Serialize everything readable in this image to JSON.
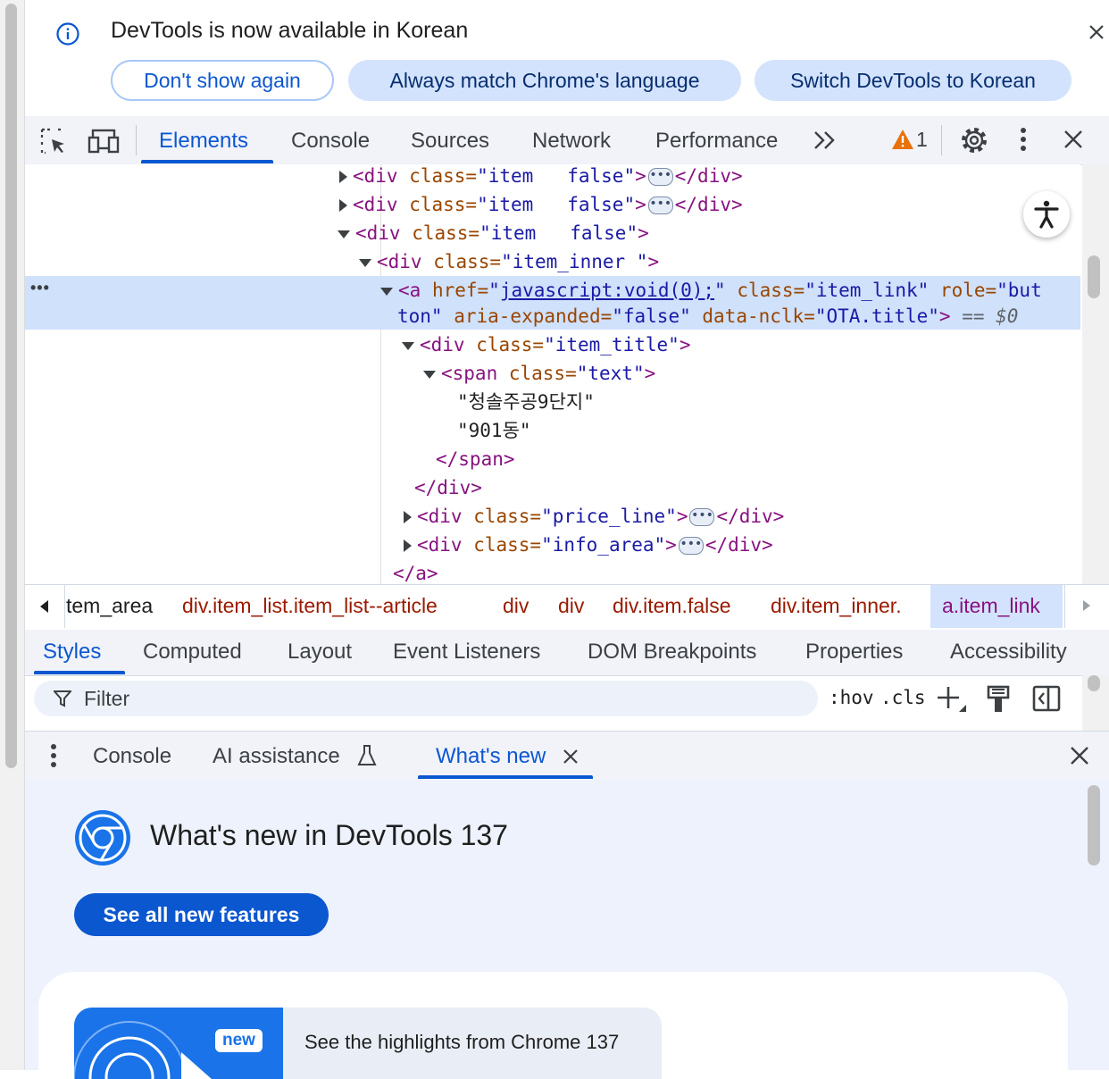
{
  "infobar": {
    "message": "DevTools is now available in Korean",
    "buttons": [
      "Don't show again",
      "Always match Chrome's language",
      "Switch DevTools to Korean"
    ]
  },
  "toolbar": {
    "tabs": [
      "Elements",
      "Console",
      "Sources",
      "Network",
      "Performance"
    ],
    "warning_count": "1"
  },
  "dom": {
    "lines": [
      {
        "open": "<div",
        "a1": " class=",
        "v1": "\"item   false\"",
        "close": ">",
        "ellipsis": true,
        "end": "</div>"
      },
      {
        "open": "<div",
        "a1": " class=",
        "v1": "\"item   false\"",
        "close": ">",
        "ellipsis": true,
        "end": "</div>"
      },
      {
        "open": "<div",
        "a1": " class=",
        "v1": "\"item   false\"",
        "close": ">"
      },
      {
        "open": "<div",
        "a1": " class=",
        "v1": "\"item_inner \"",
        "close": ">"
      }
    ],
    "selected": {
      "tag": "<a",
      "href_attr": " href=",
      "href_q1": "\"",
      "href_val": "javascript:void(0);",
      "href_q2": "\"",
      "class_attr": " class=",
      "class_val": "\"item_link\"",
      "role_attr": " role=",
      "role_val_1": "\"but",
      "role_val_2": "ton\"",
      "aria_attr": " aria-expanded=",
      "aria_val": "\"false\"",
      "nclk_attr": " data-nclk=",
      "nclk_val": "\"OTA.title\"",
      "close": ">",
      "eq": " == $0"
    },
    "item_title": {
      "open": "<div",
      "attr": " class=",
      "val": "\"item_title\"",
      "close": ">"
    },
    "span": {
      "open": "<span",
      "attr": " class=",
      "val": "\"text\"",
      "close": ">"
    },
    "text1": "\"청솔주공9단지\"",
    "text2": "\"901동\"",
    "span_end": "</span>",
    "div_end": "</div>",
    "price": {
      "open": "<div",
      "attr": " class=",
      "val": "\"price_line\"",
      "close": ">",
      "end": "</div>"
    },
    "info": {
      "open": "<div",
      "attr": " class=",
      "val": "\"info_area\"",
      "close": ">",
      "end": "</div>"
    },
    "a_end": "</a>"
  },
  "breadcrumbs": [
    "tem_area",
    "div.item_list.item_list--article",
    "div",
    "div",
    "div.item.false",
    "div.item_inner.",
    "a.item_link"
  ],
  "styles_tabs": [
    "Styles",
    "Computed",
    "Layout",
    "Event Listeners",
    "DOM Breakpoints",
    "Properties",
    "Accessibility"
  ],
  "filter": {
    "placeholder": "Filter",
    "hov": ":hov",
    "cls": ".cls"
  },
  "drawer": {
    "tabs": [
      "Console",
      "AI assistance",
      "What's new"
    ]
  },
  "whats_new": {
    "title": "What's new in DevTools 137",
    "button": "See all new features",
    "badge": "new",
    "highlight": "See the highlights from Chrome 137"
  },
  "colors": {
    "accent": "#0b57d0",
    "selected_row": "#cfe1fb",
    "warning": "#e8710a"
  }
}
